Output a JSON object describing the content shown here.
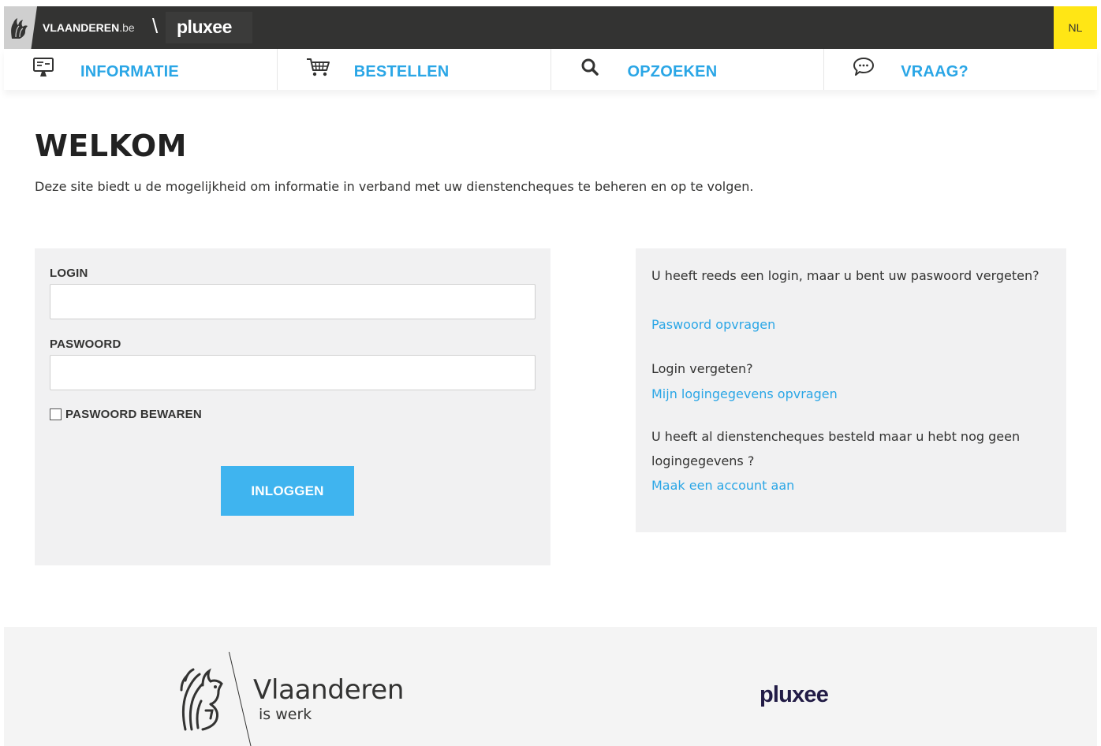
{
  "header": {
    "vlaanderen_label": "VLAANDEREN",
    "vlaanderen_suffix": ".be",
    "separator": "\\",
    "brand": "pluxee",
    "language": "NL"
  },
  "nav": {
    "items": [
      {
        "label": "INFORMATIE",
        "icon": "monitor-icon"
      },
      {
        "label": "BESTELLEN",
        "icon": "cart-icon"
      },
      {
        "label": "OPZOEKEN",
        "icon": "search-icon"
      },
      {
        "label": "VRAAG?",
        "icon": "chat-bubble-icon"
      }
    ]
  },
  "main": {
    "title": "WELKOM",
    "intro": "Deze site biedt u de mogelijkheid om informatie in verband met uw dienstencheques te beheren en op te volgen."
  },
  "login_form": {
    "login_label": "LOGIN",
    "login_value": "",
    "password_label": "PASWOORD",
    "password_value": "",
    "remember_label": "PASWOORD BEWAREN",
    "remember_checked": false,
    "submit_label": "INLOGGEN"
  },
  "help": {
    "forgot_password_text": "U heeft reeds een login, maar u bent uw paswoord vergeten?",
    "forgot_password_link": "Paswoord opvragen",
    "forgot_login_text": "Login vergeten?",
    "forgot_login_link": "Mijn logingegevens opvragen",
    "no_account_text": "U heeft al dienstencheques besteld maar u hebt nog geen logingegevens ?",
    "no_account_link": "Maak een account aan"
  },
  "footer": {
    "vlaanderen_word": "Vlaanderen",
    "vlaanderen_tagline": "is werk",
    "brand": "pluxee"
  },
  "colors": {
    "topbar": "#333332",
    "accent_blue": "#2aa6e6",
    "button_blue": "#3fb4ef",
    "language_yellow": "#ffe615",
    "panel_grey": "#f1f1f2",
    "pluxee_navy": "#221c46"
  }
}
